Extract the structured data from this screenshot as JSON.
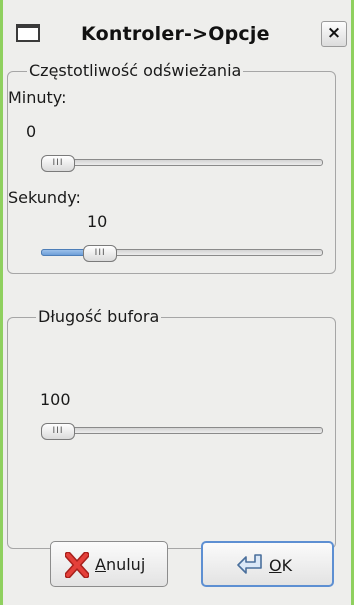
{
  "window": {
    "title": "Kontroler->Opcje",
    "close_glyph": "×",
    "accent_color": "#8fd05f"
  },
  "refresh_group": {
    "label": "Częstotliwość odświeżania",
    "minutes_label": "Minuty:",
    "minutes_value": "0",
    "minutes_slider_fraction": 0.0,
    "seconds_label": "Sekundy:",
    "seconds_value": "10",
    "seconds_slider_fraction": 0.17
  },
  "buffer_group": {
    "label": "Długość bufora",
    "value": "100",
    "slider_fraction": 0.0
  },
  "buttons": {
    "cancel": {
      "mnemonic": "A",
      "rest": "nuluj",
      "icon": "red-x-icon"
    },
    "ok": {
      "mnemonic": "O",
      "rest": "K",
      "icon": "ok-arrow-icon"
    }
  },
  "slider_thumb_grip": "III",
  "colors": {
    "panel_bg": "#eeeeec",
    "slider_fill": "#6e9fd8",
    "focus_border": "#5d8fd2",
    "cancel_icon": "#d9302c"
  }
}
